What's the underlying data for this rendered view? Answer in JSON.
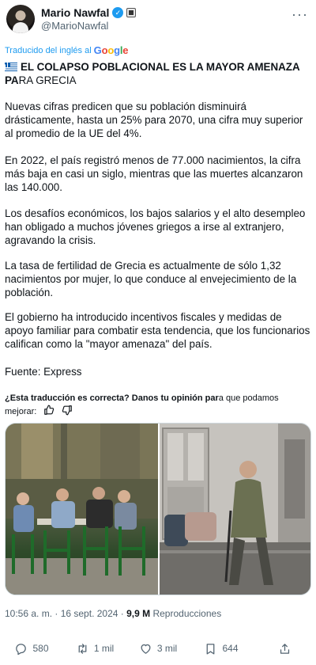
{
  "author": {
    "name": "Mario Nawfal",
    "handle": "@MarioNawfal"
  },
  "translation": {
    "label": "Traducido del inglés al",
    "brand_g1": "G",
    "brand_o1": "o",
    "brand_o2": "o",
    "brand_g2": "g",
    "brand_l": "l",
    "brand_e": "e"
  },
  "tweet": {
    "headline_bold": "EL COLAPSO POBLACIONAL ES LA MAYOR AMENAZA PA",
    "headline_rest": "RA GRECIA",
    "paragraphs": [
      "Nuevas cifras predicen que su población disminuirá drásticamente, hasta un 25% para 2070, una cifra muy superior al promedio de la UE del 4%.",
      "En 2022, el país registró menos de 77.000 nacimientos, la cifra más baja en casi un siglo, mientras que las muertes alcanzaron las 140.000.",
      "Los desafíos económicos, los bajos salarios y el alto desempleo han obligado a muchos jóvenes griegos a irse al extranjero, agravando la crisis.",
      "La tasa de fertilidad de Grecia es actualmente de sólo 1,32 nacimientos por mujer, lo que conduce al envejecimiento de la población.",
      "El gobierno ha introducido incentivos fiscales y medidas de apoyo familiar para combatir esta tendencia, que los funcionarios califican como la \"mayor amenaza\" del país.",
      "Fuente: Express"
    ]
  },
  "feedback": {
    "question_bold": "¿Esta traducción es correcta? Danos tu opinión par",
    "question_rest": "a que podamos mejorar:"
  },
  "meta": {
    "time_date": "10:56 a. m. · 16 sept. 2024 ·",
    "views_count": "9,9 M",
    "views_label": "Reproducciones"
  },
  "actions": {
    "replies": "580",
    "reposts": "1 mil",
    "likes": "3 mil",
    "bookmarks": "644"
  },
  "colors": {
    "accent": "#1d9bf0",
    "text": "#0f1419",
    "muted": "#536471"
  }
}
